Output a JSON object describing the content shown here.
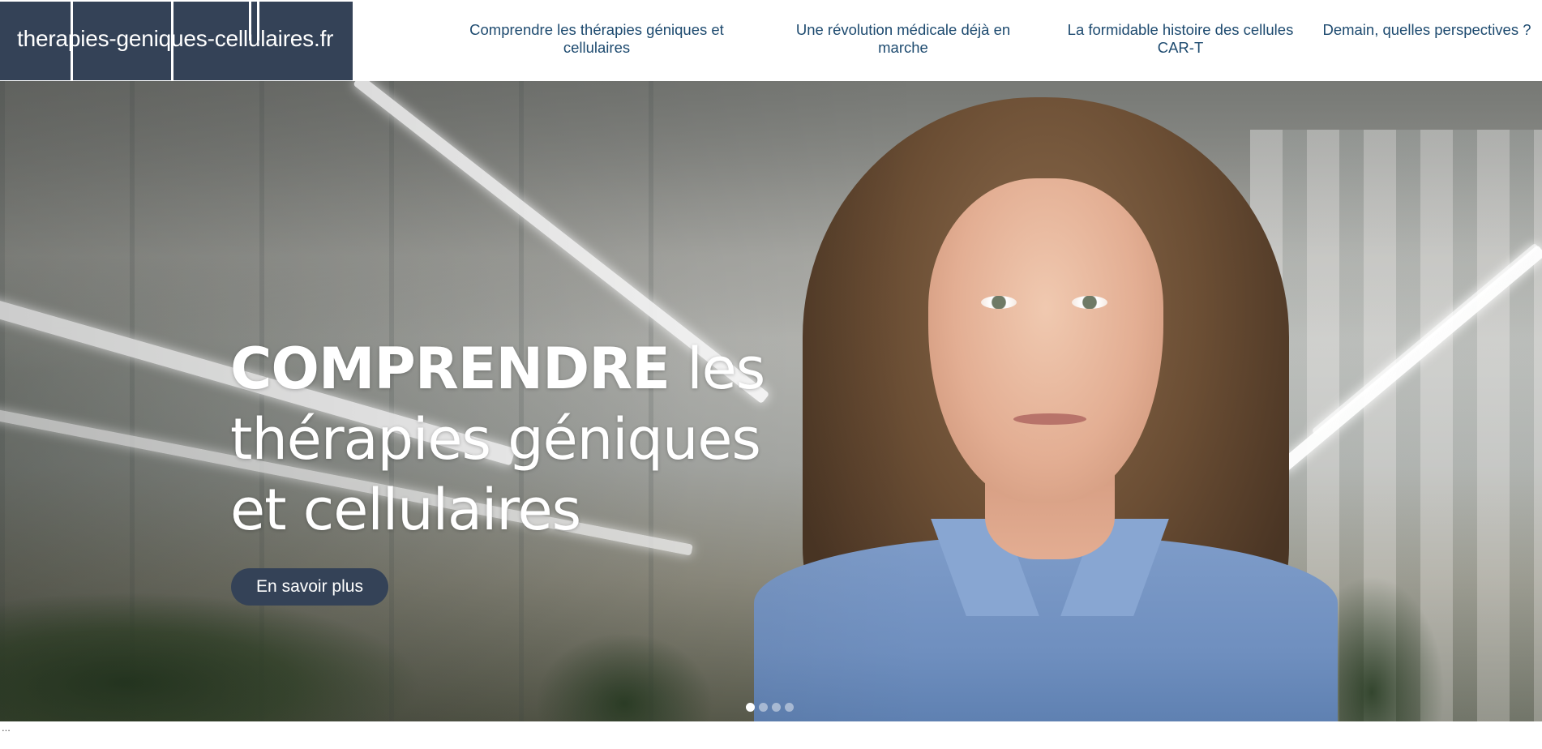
{
  "header": {
    "logo_text": "therapies-geniques-cellulaires.fr",
    "logo_color": "#344257",
    "nav_color": "#1d4a6f",
    "nav": [
      {
        "label": "Comprendre les thérapies géniques et cellulaires"
      },
      {
        "label": "Une révolution médicale déjà en marche"
      },
      {
        "label": "La formidable histoire des cellules CAR-T"
      },
      {
        "label": "Demain, quelles perspectives ?"
      }
    ]
  },
  "hero": {
    "title_strong": "COMPRENDRE",
    "title_rest": " les thérapies géniques et cellulaires",
    "button_label": "En savoir plus",
    "button_color": "#344257",
    "slides_total": 4,
    "active_slide": 1
  },
  "footer": {
    "ellipsis": "..."
  }
}
